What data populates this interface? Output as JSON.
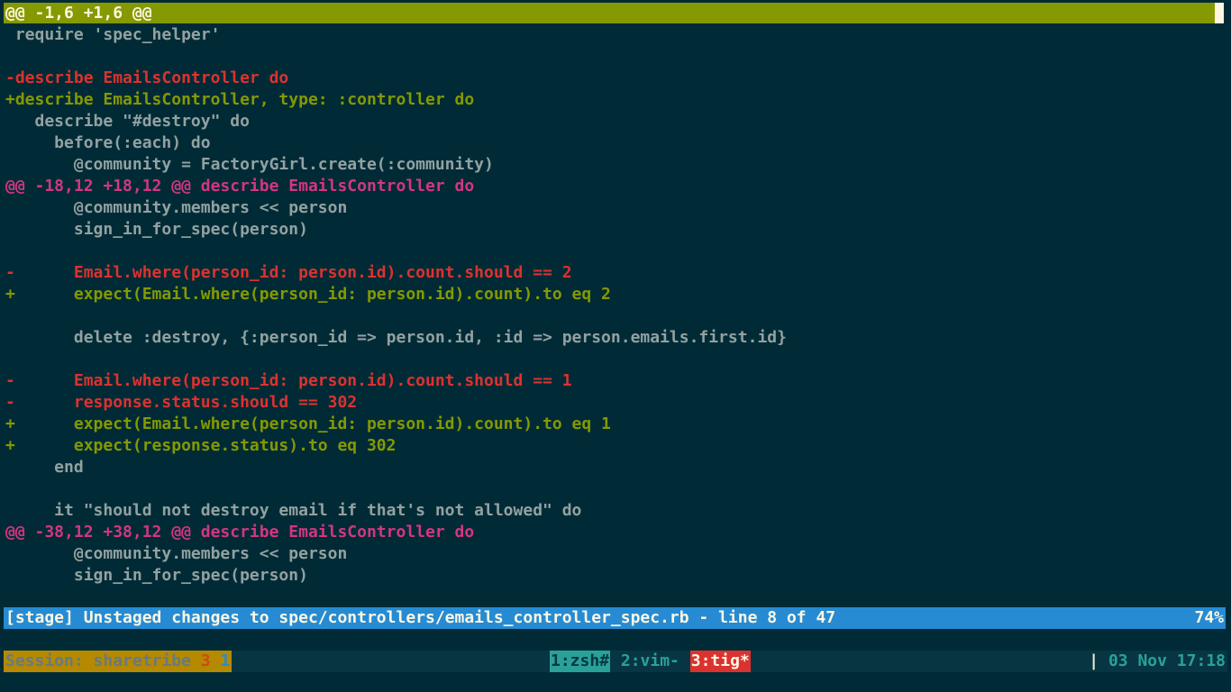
{
  "hunk_header_top": "@@ -1,6 +1,6 @@",
  "diff_lines": [
    {
      "kind": "context",
      "text": " require 'spec_helper'"
    },
    {
      "kind": "context",
      "text": ""
    },
    {
      "kind": "del",
      "text": "-describe EmailsController do"
    },
    {
      "kind": "add",
      "text": "+describe EmailsController, type: :controller do"
    },
    {
      "kind": "context",
      "text": "   describe \"#destroy\" do"
    },
    {
      "kind": "context",
      "text": "     before(:each) do"
    },
    {
      "kind": "context",
      "text": "       @community = FactoryGirl.create(:community)"
    },
    {
      "kind": "hunk",
      "text": "@@ -18,12 +18,12 @@ describe EmailsController do"
    },
    {
      "kind": "context",
      "text": "       @community.members << person"
    },
    {
      "kind": "context",
      "text": "       sign_in_for_spec(person)"
    },
    {
      "kind": "context",
      "text": ""
    },
    {
      "kind": "del",
      "text": "-      Email.where(person_id: person.id).count.should == 2"
    },
    {
      "kind": "add",
      "text": "+      expect(Email.where(person_id: person.id).count).to eq 2"
    },
    {
      "kind": "context",
      "text": ""
    },
    {
      "kind": "context",
      "text": "       delete :destroy, {:person_id => person.id, :id => person.emails.first.id}"
    },
    {
      "kind": "context",
      "text": ""
    },
    {
      "kind": "del",
      "text": "-      Email.where(person_id: person.id).count.should == 1"
    },
    {
      "kind": "del",
      "text": "-      response.status.should == 302"
    },
    {
      "kind": "add",
      "text": "+      expect(Email.where(person_id: person.id).count).to eq 1"
    },
    {
      "kind": "add",
      "text": "+      expect(response.status).to eq 302"
    },
    {
      "kind": "context",
      "text": "     end"
    },
    {
      "kind": "context",
      "text": ""
    },
    {
      "kind": "context",
      "text": "     it \"should not destroy email if that's not allowed\" do"
    },
    {
      "kind": "hunk",
      "text": "@@ -38,12 +38,12 @@ describe EmailsController do"
    },
    {
      "kind": "context",
      "text": "       @community.members << person"
    },
    {
      "kind": "context",
      "text": "       sign_in_for_spec(person)"
    }
  ],
  "status": {
    "text": "[stage] Unstaged changes to spec/controllers/emails_controller_spec.rb - line 8 of 47",
    "percent": "74%"
  },
  "tmux": {
    "session_label": "Session: sharetribe",
    "session_num": "3",
    "session_num2": "1",
    "windows": [
      {
        "label": "1:zsh#"
      },
      {
        "label": "2:vim-"
      },
      {
        "label": "3:tig*"
      }
    ],
    "clock_sep": "|",
    "clock": "03 Nov 17:18"
  },
  "colors": {
    "background": "#002b36",
    "added": "#859900",
    "deleted": "#dc322f",
    "hunk": "#d33682",
    "context": "#93a1a1",
    "status_bar": "#268bd2"
  }
}
